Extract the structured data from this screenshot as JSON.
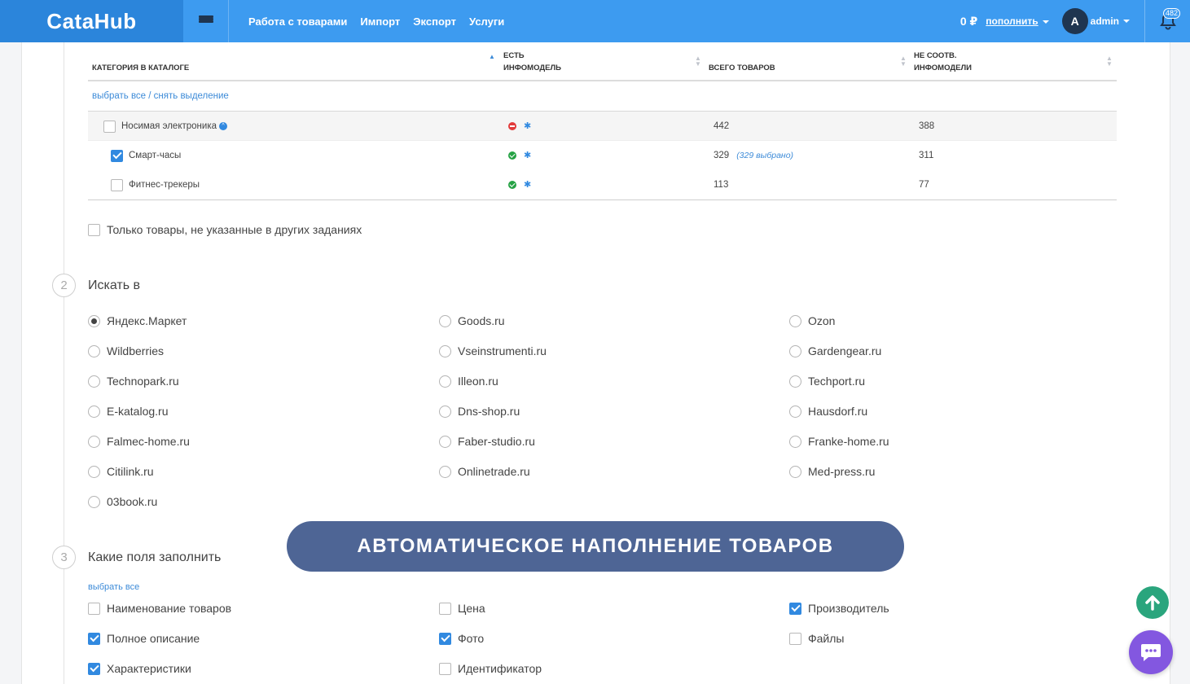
{
  "header": {
    "logo": "CataHub",
    "nav": [
      "Работа с товарами",
      "Импорт",
      "Экспорт",
      "Услуги"
    ],
    "balance": "0 ₽",
    "topup": "пополнить",
    "avatar_letter": "A",
    "username": "admin",
    "notifications": "482"
  },
  "table": {
    "col_category": "Категория в каталоге",
    "col_infomodel": [
      "Есть",
      "инфомодель"
    ],
    "col_total": "Всего товаров",
    "col_nonmatch": [
      "Не соотв.",
      "инфомодели"
    ],
    "select_all": "выбрать все / снять выделение",
    "rows": [
      {
        "name": "Носимая электроника",
        "total": "442",
        "nonmatch": "388",
        "selected_note": ""
      },
      {
        "name": "Смарт-часы",
        "total": "329",
        "nonmatch": "311",
        "selected_note": "(329 выбрано)"
      },
      {
        "name": "Фитнес-трекеры",
        "total": "113",
        "nonmatch": "77",
        "selected_note": ""
      }
    ]
  },
  "only_unassigned": "Только товары, не указанные в других заданиях",
  "section2": {
    "number": "2",
    "title": "Искать в",
    "options": [
      "Яндекс.Маркет",
      "Goods.ru",
      "Ozon",
      "Wildberries",
      "Vseinstrumenti.ru",
      "Gardengear.ru",
      "Technopark.ru",
      "Illeon.ru",
      "Techport.ru",
      "E-katalog.ru",
      "Dns-shop.ru",
      "Hausdorf.ru",
      "Falmec-home.ru",
      "Faber-studio.ru",
      "Franke-home.ru",
      "Citilink.ru",
      "Onlinetrade.ru",
      "Med-press.ru",
      "03book.ru"
    ],
    "selected": "Яндекс.Маркет"
  },
  "section3": {
    "number": "3",
    "title": "Какие поля заполнить",
    "select_all": "выбрать все",
    "fields": [
      {
        "label": "Наименование товаров",
        "checked": false
      },
      {
        "label": "Цена",
        "checked": false
      },
      {
        "label": "Производитель",
        "checked": true
      },
      {
        "label": "Полное описание",
        "checked": true
      },
      {
        "label": "Фото",
        "checked": true
      },
      {
        "label": "Файлы",
        "checked": false
      },
      {
        "label": "Характеристики",
        "checked": true
      },
      {
        "label": "Идентификатор",
        "checked": false
      }
    ]
  },
  "banner": "АВТОМАТИЧЕСКОЕ НАПОЛНЕНИЕ ТОВАРОВ",
  "colors": {
    "topbar": "#3d9bf0",
    "logo_bg": "#2b85db",
    "accent": "#3189e0",
    "banner": "#4e6595",
    "scroll_up": "#2aa57d",
    "chat": "#8357e0"
  }
}
